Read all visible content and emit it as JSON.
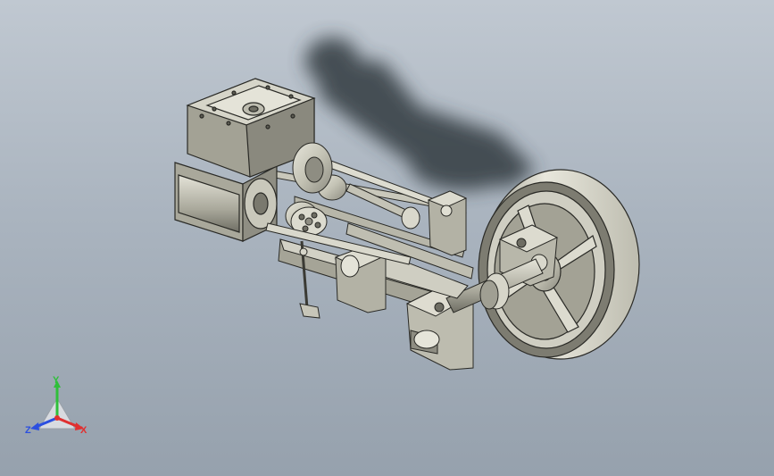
{
  "viewport": {
    "background_top": "#c0c8d1",
    "background_bottom": "#96a1ad",
    "model_subject": "steam-engine-assembly"
  },
  "triad": {
    "x_label": "X",
    "y_label": "Y",
    "z_label": "Z",
    "x_color": "#e03030",
    "y_color": "#2fbf3a",
    "z_color": "#2b4fe0"
  },
  "palette": {
    "metal_light": "#d9d8cc",
    "metal_mid": "#b5b4a6",
    "metal_dark": "#6e6d63",
    "edge": "#2a2a26",
    "shadow": "#333a40"
  }
}
